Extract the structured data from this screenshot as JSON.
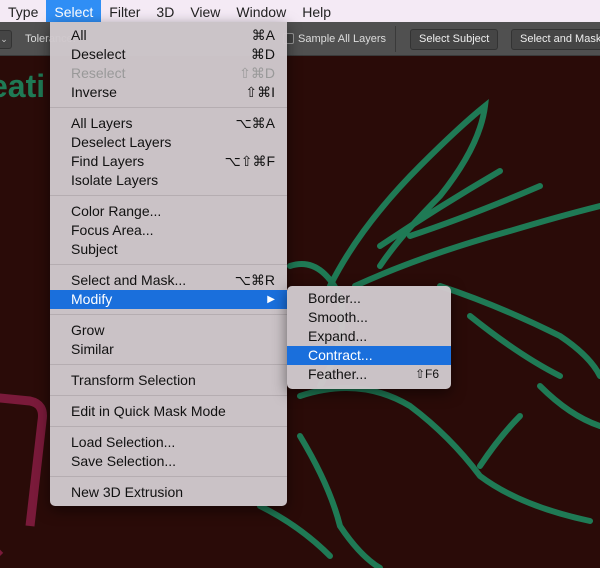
{
  "menubar": [
    "Type",
    "Select",
    "Filter",
    "3D",
    "View",
    "Window",
    "Help"
  ],
  "options": {
    "tolerance_label": "Tolerance:",
    "sample_all_layers": "Sample All Layers",
    "select_subject": "Select Subject",
    "select_and_mask": "Select and Mask..."
  },
  "canvas": {
    "title_fragment": "eati",
    "colors": {
      "background": "#2a0b08",
      "selection": "#1f7a55",
      "shape": "#7a1a3a"
    }
  },
  "select_menu": [
    [
      {
        "label": "All",
        "shortcut": "⌘A"
      },
      {
        "label": "Deselect",
        "shortcut": "⌘D"
      },
      {
        "label": "Reselect",
        "shortcut": "⇧⌘D",
        "disabled": true
      },
      {
        "label": "Inverse",
        "shortcut": "⇧⌘I"
      }
    ],
    [
      {
        "label": "All Layers",
        "shortcut": "⌥⌘A"
      },
      {
        "label": "Deselect Layers",
        "shortcut": ""
      },
      {
        "label": "Find Layers",
        "shortcut": "⌥⇧⌘F"
      },
      {
        "label": "Isolate Layers",
        "shortcut": ""
      }
    ],
    [
      {
        "label": "Color Range...",
        "shortcut": ""
      },
      {
        "label": "Focus Area...",
        "shortcut": ""
      },
      {
        "label": "Subject",
        "shortcut": ""
      }
    ],
    [
      {
        "label": "Select and Mask...",
        "shortcut": "⌥⌘R"
      },
      {
        "label": "Modify",
        "shortcut": "▶",
        "highlighted": true
      }
    ],
    [
      {
        "label": "Grow",
        "shortcut": ""
      },
      {
        "label": "Similar",
        "shortcut": ""
      }
    ],
    [
      {
        "label": "Transform Selection",
        "shortcut": ""
      }
    ],
    [
      {
        "label": "Edit in Quick Mask Mode",
        "shortcut": ""
      }
    ],
    [
      {
        "label": "Load Selection...",
        "shortcut": ""
      },
      {
        "label": "Save Selection...",
        "shortcut": ""
      }
    ],
    [
      {
        "label": "New 3D Extrusion",
        "shortcut": ""
      }
    ]
  ],
  "modify_submenu": [
    {
      "label": "Border...",
      "shortcut": ""
    },
    {
      "label": "Smooth...",
      "shortcut": ""
    },
    {
      "label": "Expand...",
      "shortcut": ""
    },
    {
      "label": "Contract...",
      "shortcut": "",
      "highlighted": true
    },
    {
      "label": "Feather...",
      "shortcut": "⇧F6"
    }
  ]
}
